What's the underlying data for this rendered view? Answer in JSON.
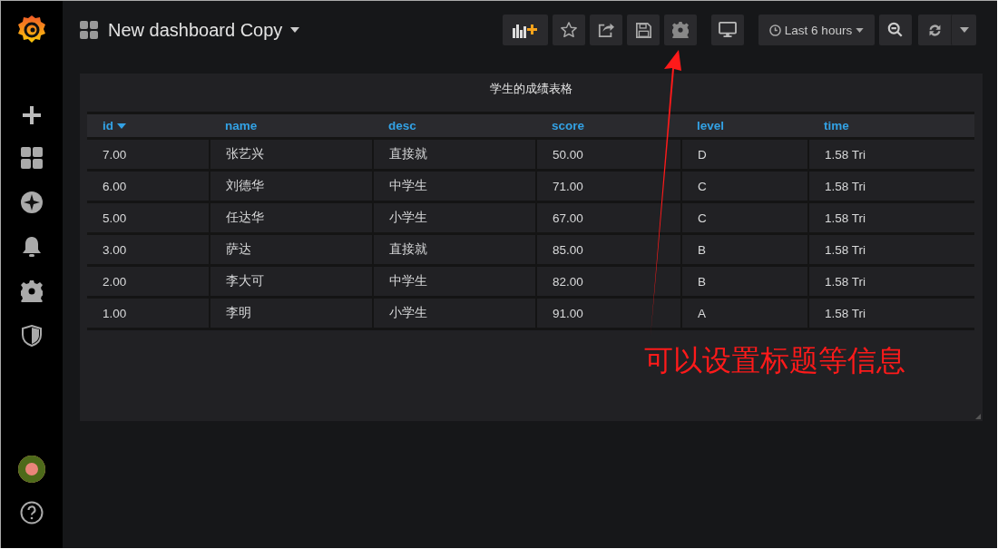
{
  "dashboard": {
    "title": "New dashboard Copy"
  },
  "toolbar": {
    "time_range": "Last 6 hours"
  },
  "panel": {
    "title": "学生的成绩表格",
    "table": {
      "columns": [
        {
          "label": "id",
          "sorted": true
        },
        {
          "label": "name",
          "sorted": false
        },
        {
          "label": "desc",
          "sorted": false
        },
        {
          "label": "score",
          "sorted": false
        },
        {
          "label": "level",
          "sorted": false
        },
        {
          "label": "time",
          "sorted": false
        }
      ],
      "rows": [
        [
          "7.00",
          "张艺兴",
          "直接就",
          "50.00",
          "D",
          "1.58 Tri"
        ],
        [
          "6.00",
          "刘德华",
          "中学生",
          "71.00",
          "C",
          "1.58 Tri"
        ],
        [
          "5.00",
          "任达华",
          "小学生",
          "67.00",
          "C",
          "1.58 Tri"
        ],
        [
          "3.00",
          "萨达",
          "直接就",
          "85.00",
          "B",
          "1.58 Tri"
        ],
        [
          "2.00",
          "李大可",
          "中学生",
          "82.00",
          "B",
          "1.58 Tri"
        ],
        [
          "1.00",
          "李明",
          "小学生",
          "91.00",
          "A",
          "1.58 Tri"
        ]
      ]
    }
  },
  "annotation": {
    "text": "可以设置标题等信息"
  }
}
